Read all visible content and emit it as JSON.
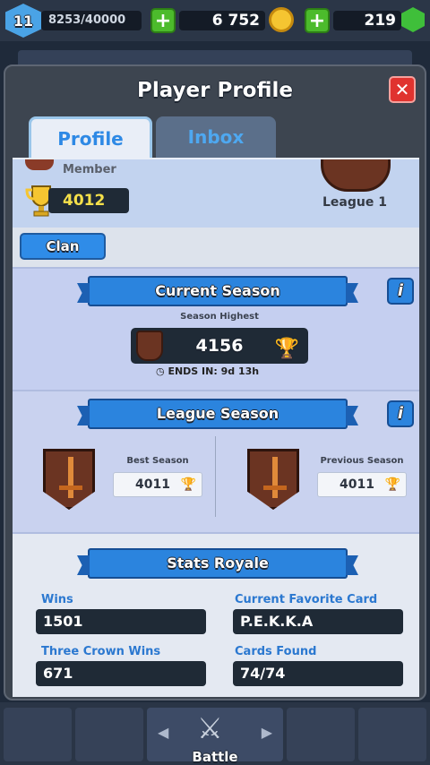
{
  "status_bar": {
    "level": "11",
    "xp": "8253/40000",
    "gold": "6 752",
    "gems": "219"
  },
  "modal": {
    "title": "Player Profile",
    "close_icon": "close-x-icon"
  },
  "tabs": [
    {
      "label": "Profile",
      "active": true
    },
    {
      "label": "Inbox",
      "active": false
    }
  ],
  "profile": {
    "role": "Member",
    "trophies": "4012",
    "league": "League 1",
    "clan_button": "Clan"
  },
  "current_season": {
    "title": "Current Season",
    "season_highest_label": "Season Highest",
    "season_highest": "4156",
    "ends_in": "ENDS IN: 9d 13h"
  },
  "league_season": {
    "title": "League Season",
    "best_label": "Best Season",
    "best_value": "4011",
    "previous_label": "Previous Season",
    "previous_value": "4011"
  },
  "stats": {
    "title": "Stats Royale",
    "wins_label": "Wins",
    "wins": "1501",
    "favorite_label": "Current Favorite Card",
    "favorite": "P.E.K.K.A",
    "three_crown_label": "Three Crown Wins",
    "three_crown": "671",
    "cards_found_label": "Cards Found",
    "cards_found": "74/74"
  },
  "bottom_nav": {
    "battle_label": "Battle"
  },
  "colors": {
    "accent_blue": "#2b84de",
    "close_red": "#e0332f",
    "trophy_gold": "#f5c531"
  }
}
